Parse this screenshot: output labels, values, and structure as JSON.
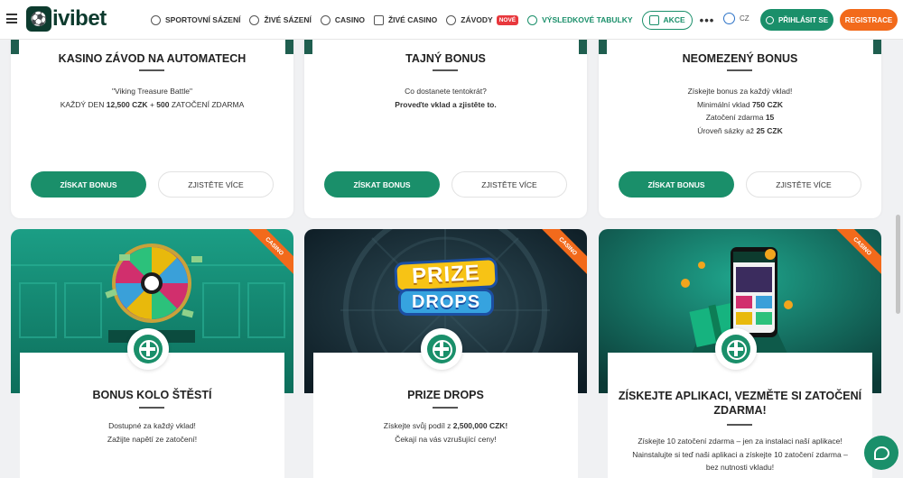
{
  "header": {
    "logo_mark": "⚽",
    "logo_text": "ivibet",
    "nav": [
      {
        "label": "SPORTOVNÍ SÁZENÍ",
        "icon": "football-icon"
      },
      {
        "label": "ŽIVÉ SÁZENÍ",
        "icon": "live-icon"
      },
      {
        "label": "CASINO",
        "icon": "casino-chip-icon"
      },
      {
        "label": "ŽIVÉ CASINO",
        "icon": "cards-icon"
      },
      {
        "label": "ZÁVODY",
        "icon": "rocket-icon",
        "badge": "NOVÉ"
      },
      {
        "label": "VÝSLEDKOVÉ TABULKY",
        "icon": "trophy-icon"
      }
    ],
    "akce": "AKCE",
    "more": "•••",
    "lang": "CZ",
    "login": "PŘIHLÁSIT SE",
    "register": "REGISTRACE"
  },
  "top_cards": [
    {
      "title": "KASINO ZÁVOD NA AUTOMATECH",
      "lines": [
        "\"Viking Treasure Battle\""
      ],
      "line2_pre": "KAŽDÝ DEN ",
      "line2_b1": "12,500 CZK",
      "line2_mid": " + ",
      "line2_b2": "500",
      "line2_post": " ZATOČENÍ ZDARMA",
      "primary": "ZÍSKAT BONUS",
      "secondary": "ZJISTĚTE VÍCE"
    },
    {
      "title": "TAJNÝ BONUS",
      "line1": "Co dostanete tentokrát?",
      "line2": "Proveďte vklad a zjistěte to.",
      "primary": "ZÍSKAT BONUS",
      "secondary": "ZJISTĚTE VÍCE"
    },
    {
      "title": "NEOMEZENÝ BONUS",
      "line1": "Získejte bonus za každý vklad!",
      "line2_pre": "Minimální vklad ",
      "line2_b": "750 CZK",
      "line3_pre": "Zatočení zdarma ",
      "line3_b": "15",
      "line4_pre": "Úroveň sázky až ",
      "line4_b": "25 CZK",
      "primary": "ZÍSKAT BONUS",
      "secondary": "ZJISTĚTE VÍCE"
    }
  ],
  "bottom_cards": [
    {
      "ribbon": "CASINO",
      "title": "BONUS KOLO ŠTĚSTÍ",
      "line1": "Dostupné za každý vklad!",
      "line2": "Zažijte napětí ze zatočení!"
    },
    {
      "ribbon": "CASINO",
      "banner_word1": "PRIZE",
      "banner_word2": "DROPS",
      "title": "PRIZE DROPS",
      "line1_pre": "Získejte svůj podíl z ",
      "line1_b": "2,500,000 CZK!",
      "line2": "Čekají na vás vzrušující ceny!"
    },
    {
      "ribbon": "CASINO",
      "title": "ZÍSKEJTE APLIKACI, VEZMĚTE SI ZATOČENÍ ZDARMA!",
      "line1": "Získejte 10 zatočení zdarma – jen za instalaci naší aplikace!",
      "line2": "Nainstalujte si teď naši aplikaci a získejte 10 zatočení zdarma –",
      "line3": "bez nutnosti vkladu!"
    }
  ],
  "colors": {
    "brand_green": "#1a8f6a",
    "accent_orange": "#f26a1b",
    "dark_green": "#0d3b2e"
  }
}
